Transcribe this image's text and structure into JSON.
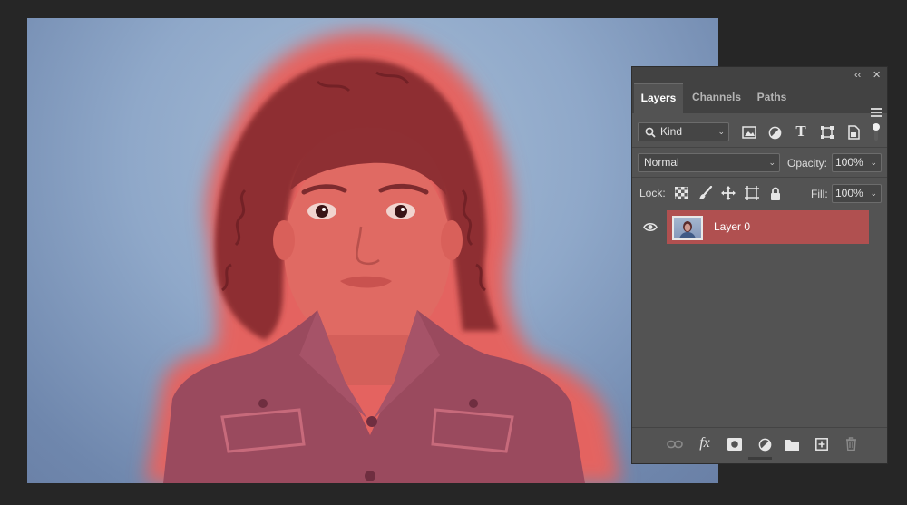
{
  "panel": {
    "collapse_glyph": "‹‹",
    "close_glyph": "✕",
    "tabs": [
      {
        "label": "Layers",
        "active": true
      },
      {
        "label": "Channels",
        "active": false
      },
      {
        "label": "Paths",
        "active": false
      }
    ],
    "filter": {
      "label": "Kind"
    },
    "blend_mode": "Normal",
    "opacity_label": "Opacity:",
    "opacity_value": "100%",
    "lock_label": "Lock:",
    "fill_label": "Fill:",
    "fill_value": "100%",
    "layers": [
      {
        "name": "Layer 0",
        "visible": true,
        "selected": true
      }
    ]
  },
  "colors": {
    "app_background": "#262626",
    "panel_background": "#535353",
    "selected_layer": "#b05050",
    "quick_mask_overlay": "#e85a58",
    "backdrop": "#8fa8c9"
  },
  "icons": {
    "filter_icons": [
      "image-filter-icon",
      "adjustment-filter-icon",
      "type-filter-icon",
      "shape-filter-icon",
      "smart-object-filter-icon"
    ],
    "lock_icons": [
      "lock-transparent-icon",
      "lock-image-icon",
      "lock-position-icon",
      "lock-artboard-icon",
      "lock-all-icon"
    ],
    "bottom_icons": [
      "link-layers-icon",
      "fx-icon",
      "add-mask-icon",
      "adjustment-layer-icon",
      "new-group-icon",
      "new-layer-icon",
      "delete-layer-icon"
    ]
  }
}
